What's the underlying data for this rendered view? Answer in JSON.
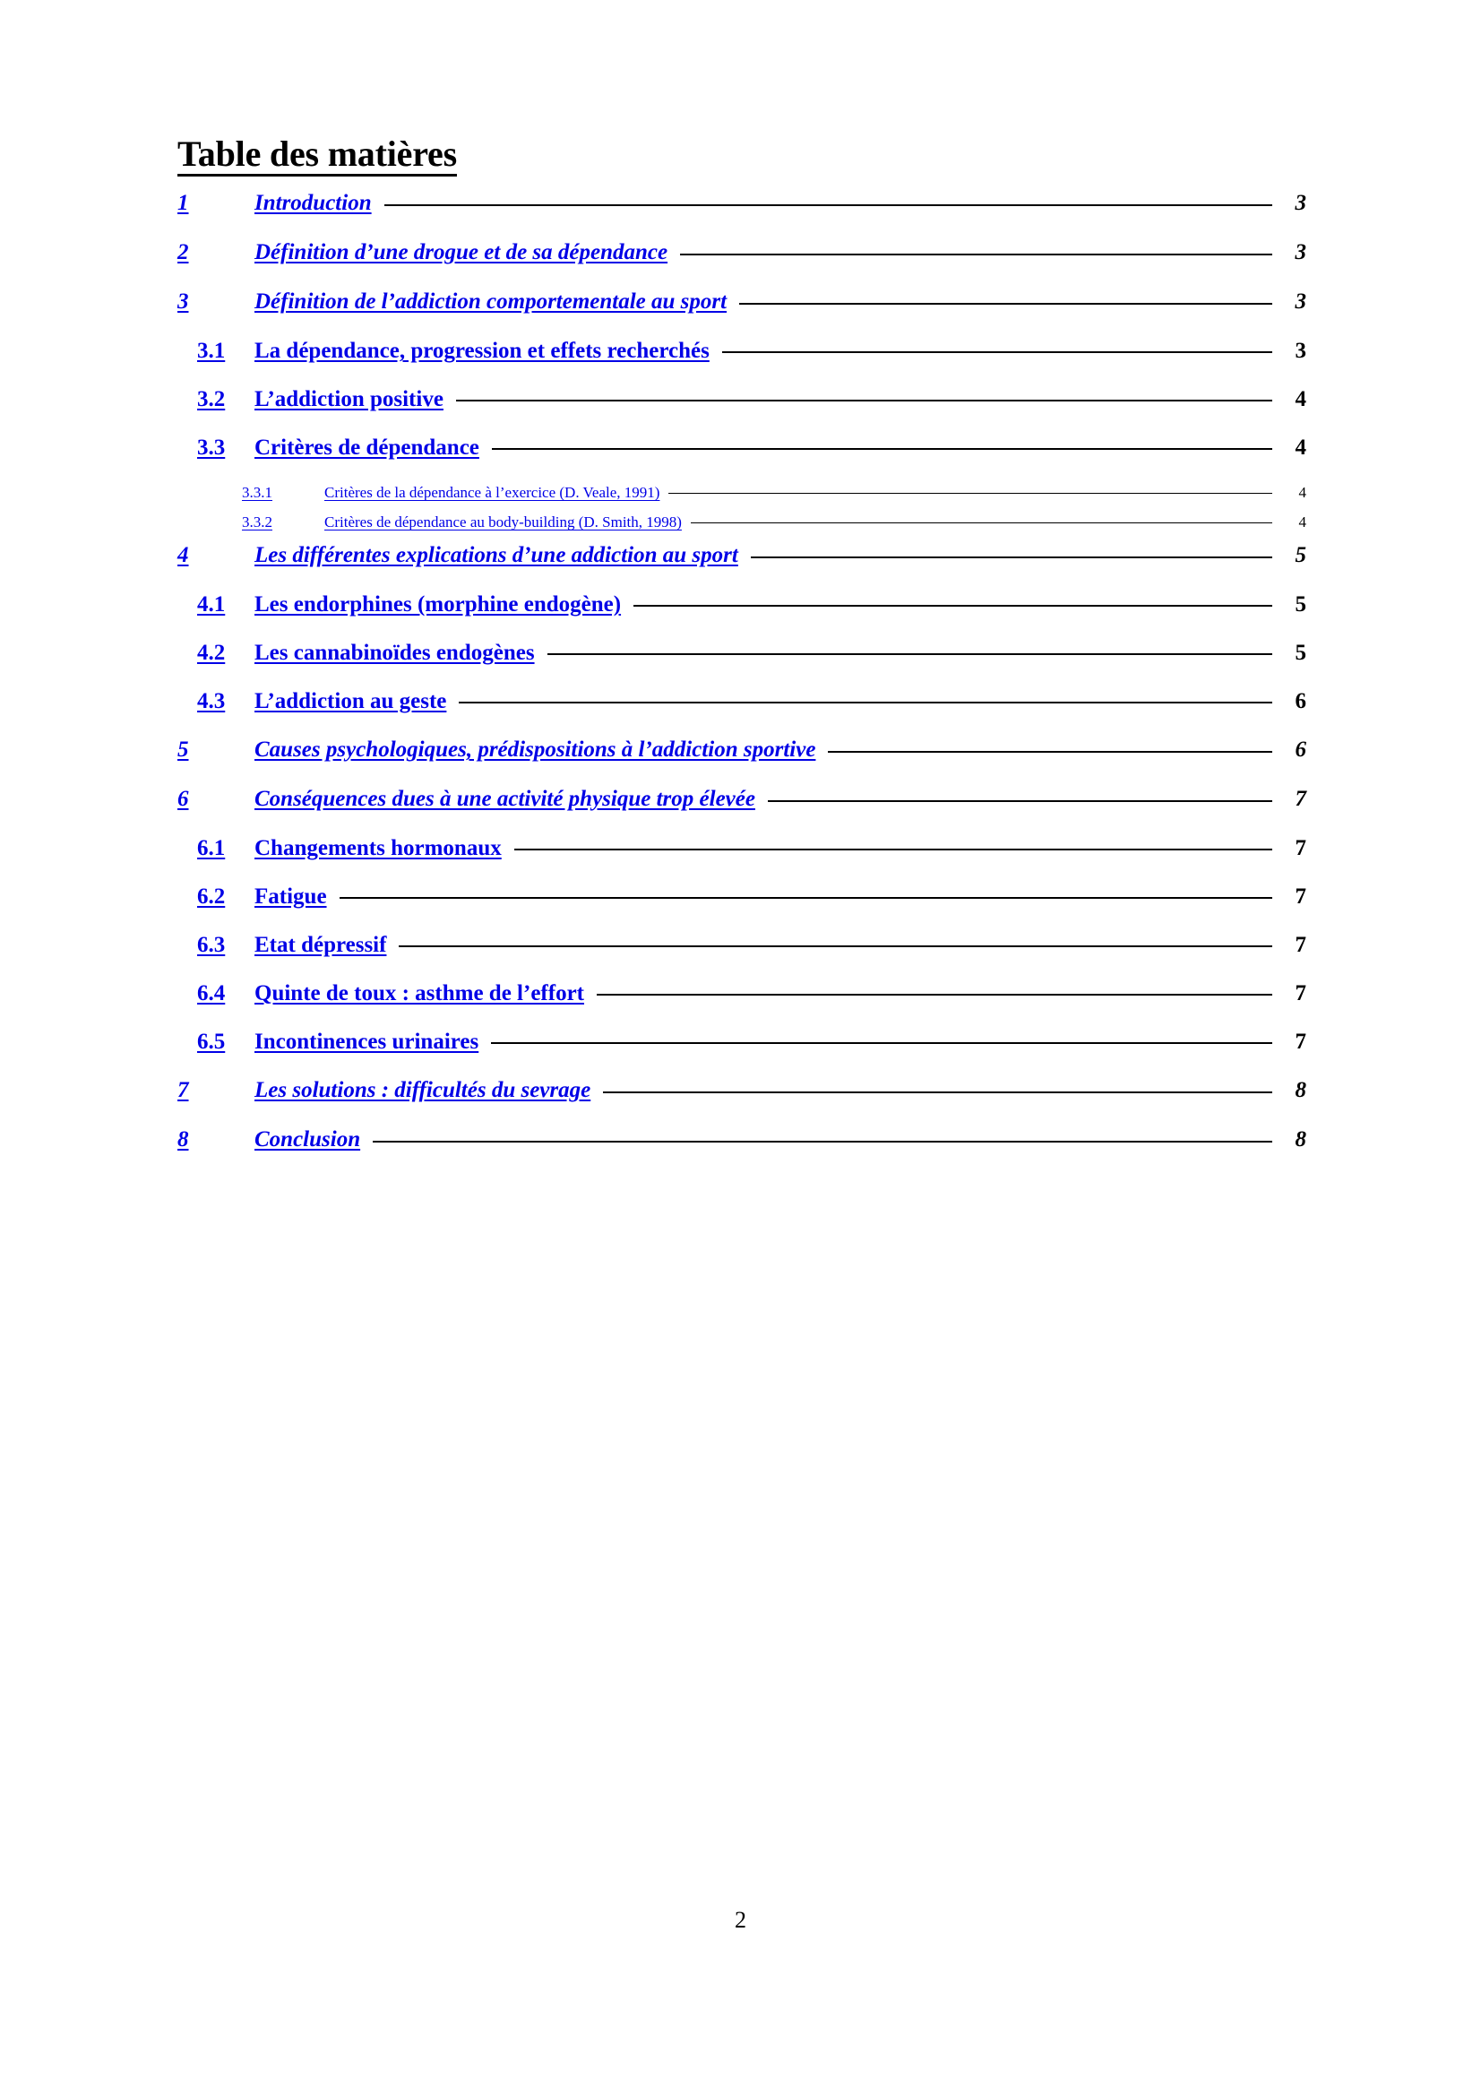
{
  "document": {
    "title": "Table des matières",
    "footer_page_number": "2",
    "link_color": "#0000e6",
    "text_color": "#000000"
  },
  "toc": {
    "entries": [
      {
        "level": 1,
        "number": "1",
        "label": "Introduction",
        "page": "3"
      },
      {
        "level": 1,
        "number": "2",
        "label": "Définition d’une drogue et de sa dépendance",
        "page": "3"
      },
      {
        "level": 1,
        "number": "3",
        "label": "Définition de l’addiction comportementale au sport",
        "page": "3"
      },
      {
        "level": 2,
        "number": "3.1",
        "label": "La dépendance, progression et effets recherchés",
        "page": "3"
      },
      {
        "level": 2,
        "number": "3.2",
        "label": "L’addiction positive",
        "page": "4"
      },
      {
        "level": 2,
        "number": "3.3",
        "label": "Critères de dépendance",
        "page": "4"
      },
      {
        "level": 3,
        "number": "3.3.1",
        "label": "Critères de la dépendance à l’exercice (D. Veale, 1991)",
        "page": "4"
      },
      {
        "level": 3,
        "number": "3.3.2",
        "label": "Critères de dépendance au body-building  (D. Smith, 1998)",
        "page": "4"
      },
      {
        "level": 1,
        "number": "4",
        "label": "Les différentes explications d’une addiction au sport",
        "page": "5"
      },
      {
        "level": 2,
        "number": "4.1",
        "label": "Les endorphines (morphine endogène)",
        "page": "5"
      },
      {
        "level": 2,
        "number": "4.2",
        "label": "Les cannabinoïdes endogènes",
        "page": "5"
      },
      {
        "level": 2,
        "number": "4.3",
        "label": "L’addiction au geste",
        "page": "6"
      },
      {
        "level": 1,
        "number": "5",
        "label": "Causes psychologiques, prédispositions à l’addiction sportive",
        "page": "6"
      },
      {
        "level": 1,
        "number": "6",
        "label": "Conséquences dues à une activité physique trop élevée",
        "page": "7"
      },
      {
        "level": 2,
        "number": "6.1",
        "label": "Changements hormonaux",
        "page": "7"
      },
      {
        "level": 2,
        "number": "6.2",
        "label": "Fatigue",
        "page": "7"
      },
      {
        "level": 2,
        "number": "6.3",
        "label": "Etat dépressif",
        "page": "7"
      },
      {
        "level": 2,
        "number": "6.4",
        "label": "Quinte de toux : asthme de l’effort",
        "page": "7"
      },
      {
        "level": 2,
        "number": "6.5",
        "label": "Incontinences urinaires",
        "page": "7"
      },
      {
        "level": 1,
        "number": "7",
        "label": "Les solutions : difficultés du sevrage",
        "page": "8"
      },
      {
        "level": 1,
        "number": "8",
        "label": "Conclusion",
        "page": "8"
      }
    ]
  }
}
